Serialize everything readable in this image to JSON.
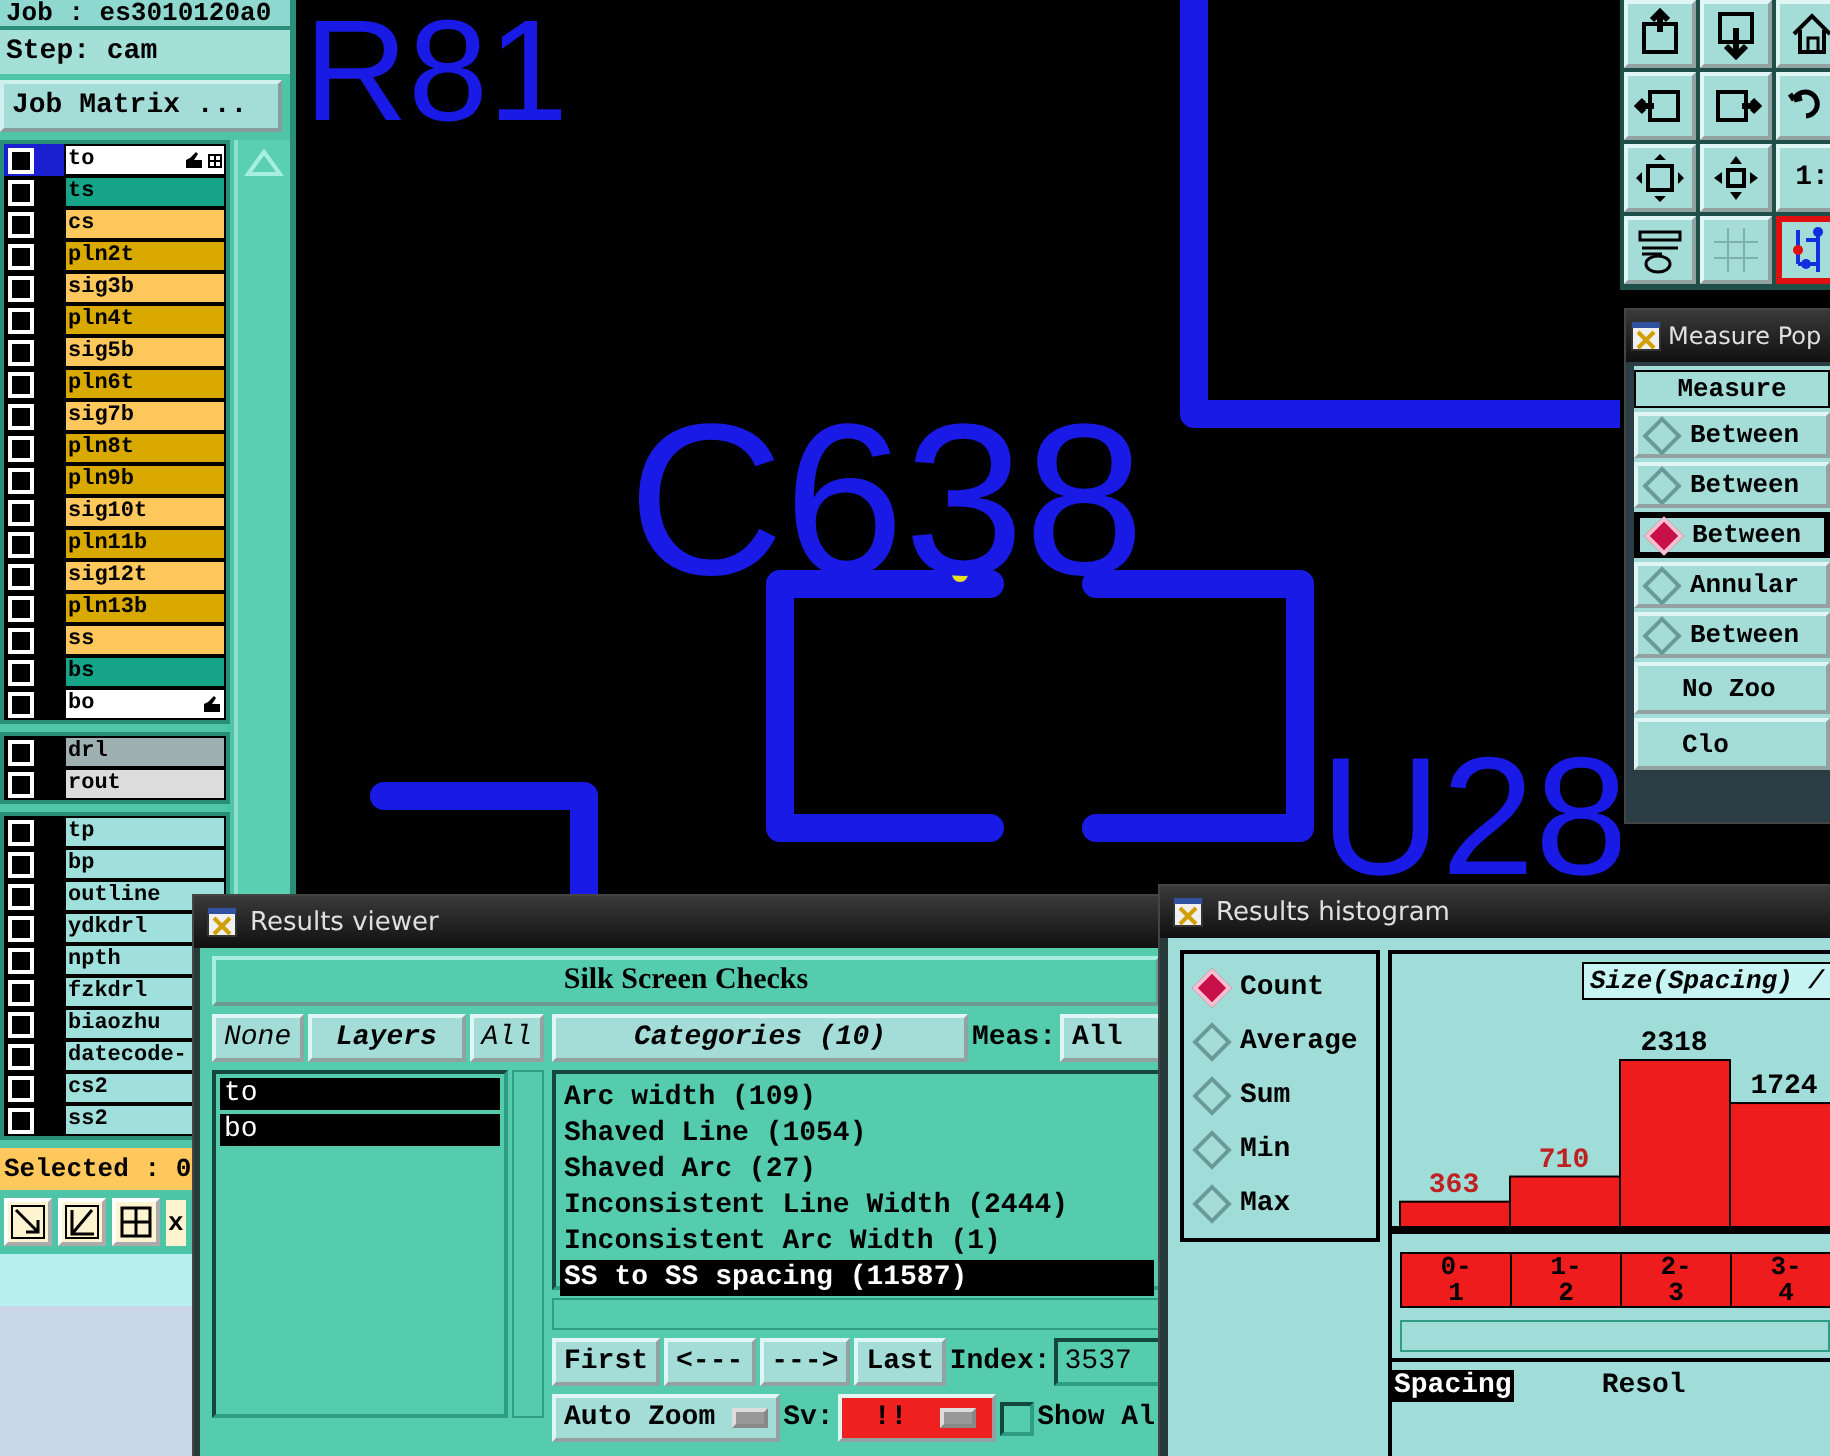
{
  "left_panel": {
    "job": "Job : es3010120a0",
    "step": "Step: cam",
    "matrix_button": "Job Matrix ...",
    "layer_groups": [
      [
        {
          "name": "to",
          "color": "#ffffff",
          "checked": false,
          "work": true,
          "affected": true
        },
        {
          "name": "ts",
          "color": "#17a589",
          "checked": false,
          "work": false,
          "affected": false
        },
        {
          "name": "cs",
          "color": "#ffc85c",
          "checked": false,
          "work": false,
          "affected": false
        },
        {
          "name": "pln2t",
          "color": "#d9a900",
          "checked": false,
          "work": false,
          "affected": false
        },
        {
          "name": "sig3b",
          "color": "#ffc85c",
          "checked": false,
          "work": false,
          "affected": false
        },
        {
          "name": "pln4t",
          "color": "#d9a900",
          "checked": false,
          "work": false,
          "affected": false
        },
        {
          "name": "sig5b",
          "color": "#ffc85c",
          "checked": false,
          "work": false,
          "affected": false
        },
        {
          "name": "pln6t",
          "color": "#d9a900",
          "checked": false,
          "work": false,
          "affected": false
        },
        {
          "name": "sig7b",
          "color": "#ffc85c",
          "checked": false,
          "work": false,
          "affected": false
        },
        {
          "name": "pln8t",
          "color": "#d9a900",
          "checked": false,
          "work": false,
          "affected": false
        },
        {
          "name": "pln9b",
          "color": "#d9a900",
          "checked": false,
          "work": false,
          "affected": false
        },
        {
          "name": "sig10t",
          "color": "#ffc85c",
          "checked": false,
          "work": false,
          "affected": false
        },
        {
          "name": "pln11b",
          "color": "#d9a900",
          "checked": false,
          "work": false,
          "affected": false
        },
        {
          "name": "sig12t",
          "color": "#ffc85c",
          "checked": false,
          "work": false,
          "affected": false
        },
        {
          "name": "pln13b",
          "color": "#d9a900",
          "checked": false,
          "work": false,
          "affected": false
        },
        {
          "name": "ss",
          "color": "#ffc85c",
          "checked": false,
          "work": false,
          "affected": false
        },
        {
          "name": "bs",
          "color": "#17a589",
          "checked": false,
          "work": false,
          "affected": false
        },
        {
          "name": "bo",
          "color": "#ffffff",
          "checked": false,
          "work": false,
          "affected": true
        }
      ],
      [
        {
          "name": "drl",
          "color": "#9fb0b0",
          "checked": false,
          "work": false,
          "affected": false
        },
        {
          "name": "rout",
          "color": "#dcdcdc",
          "checked": false,
          "work": false,
          "affected": false
        }
      ],
      [
        {
          "name": "tp",
          "color": "#a0e0dc",
          "checked": false,
          "work": false,
          "affected": false
        },
        {
          "name": "bp",
          "color": "#a0e0dc",
          "checked": false,
          "work": false,
          "affected": false
        },
        {
          "name": "outline",
          "color": "#a0e0dc",
          "checked": false,
          "work": false,
          "affected": false
        },
        {
          "name": "ydkdrl",
          "color": "#a0e0dc",
          "checked": false,
          "work": false,
          "affected": false
        },
        {
          "name": "npth",
          "color": "#a0e0dc",
          "checked": false,
          "work": false,
          "affected": false
        },
        {
          "name": "fzkdrl",
          "color": "#a0e0dc",
          "checked": false,
          "work": false,
          "affected": false
        },
        {
          "name": "biaozhu",
          "color": "#a0e0dc",
          "checked": false,
          "work": false,
          "affected": false
        },
        {
          "name": "datecode-",
          "color": "#a0e0dc",
          "checked": false,
          "work": false,
          "affected": false
        },
        {
          "name": "cs2",
          "color": "#a0e0dc",
          "checked": false,
          "work": false,
          "affected": false
        },
        {
          "name": "ss2",
          "color": "#a0e0dc",
          "checked": false,
          "work": false,
          "affected": false
        }
      ]
    ],
    "selected_count": "Selected : 0",
    "toolbar_label": "x"
  },
  "canvas": {
    "labels": [
      "R81",
      "C638",
      "U28"
    ]
  },
  "toolbar": {
    "tools": [
      {
        "selected": false
      },
      {
        "selected": false
      },
      {
        "selected": false
      },
      {
        "selected": false
      },
      {
        "selected": false
      },
      {
        "selected": false
      },
      {
        "selected": false
      },
      {
        "selected": false
      },
      {
        "selected": false,
        "label": "1:"
      },
      {
        "selected": false
      },
      {
        "selected": false
      },
      {
        "selected": true
      }
    ]
  },
  "measure_popup": {
    "title": "Measure Pop",
    "header": "Measure",
    "options": [
      {
        "label": "Between",
        "selected": false
      },
      {
        "label": "Between",
        "selected": false
      },
      {
        "label": "Between",
        "selected": true
      },
      {
        "label": "Annular",
        "selected": false
      },
      {
        "label": "Between",
        "selected": false
      }
    ],
    "buttons": [
      "No Zoo",
      "Clo"
    ]
  },
  "results_viewer": {
    "title": "Results viewer",
    "header": "Silk Screen Checks",
    "layer_buttons": {
      "none": "None",
      "title": "Layers",
      "all": "All"
    },
    "layers": [
      {
        "name": "to",
        "selected": true
      },
      {
        "name": "bo",
        "selected": true
      }
    ],
    "categories_button": "Categories (10)",
    "meas_label": "Meas:",
    "meas_value": "All",
    "categories": [
      {
        "label": "Arc width (109)",
        "selected": false
      },
      {
        "label": "Shaved Line (1054)",
        "selected": false
      },
      {
        "label": "Shaved Arc (27)",
        "selected": false
      },
      {
        "label": "Inconsistent Line Width (2444)",
        "selected": false
      },
      {
        "label": "Inconsistent Arc Width (1)",
        "selected": false
      },
      {
        "label": "SS to SS spacing (11587)",
        "selected": true
      }
    ],
    "nav_buttons": [
      "First",
      "<---",
      "--->",
      "Last"
    ],
    "index_label": "Index:",
    "index_value": "3537",
    "zoom_menu": "Auto Zoom",
    "sv_label": "Sv:",
    "sv_menu": "!!",
    "show_all": {
      "label": "Show Al",
      "checked": false
    }
  },
  "results_histogram": {
    "title": "Results histogram",
    "modes": [
      {
        "label": "Count",
        "selected": true
      },
      {
        "label": "Average",
        "selected": false
      },
      {
        "label": "Sum",
        "selected": false
      },
      {
        "label": "Min",
        "selected": false
      },
      {
        "label": "Max",
        "selected": false
      }
    ],
    "axis_title": "Size(Spacing) /",
    "chart_data": {
      "type": "bar",
      "categories": [
        "0-1",
        "1-2",
        "2-3",
        "3-4"
      ],
      "values": [
        363,
        710,
        2318,
        1724
      ],
      "data_labels": true
    },
    "list_item": "Spacing",
    "resolution_label": "Resol"
  }
}
